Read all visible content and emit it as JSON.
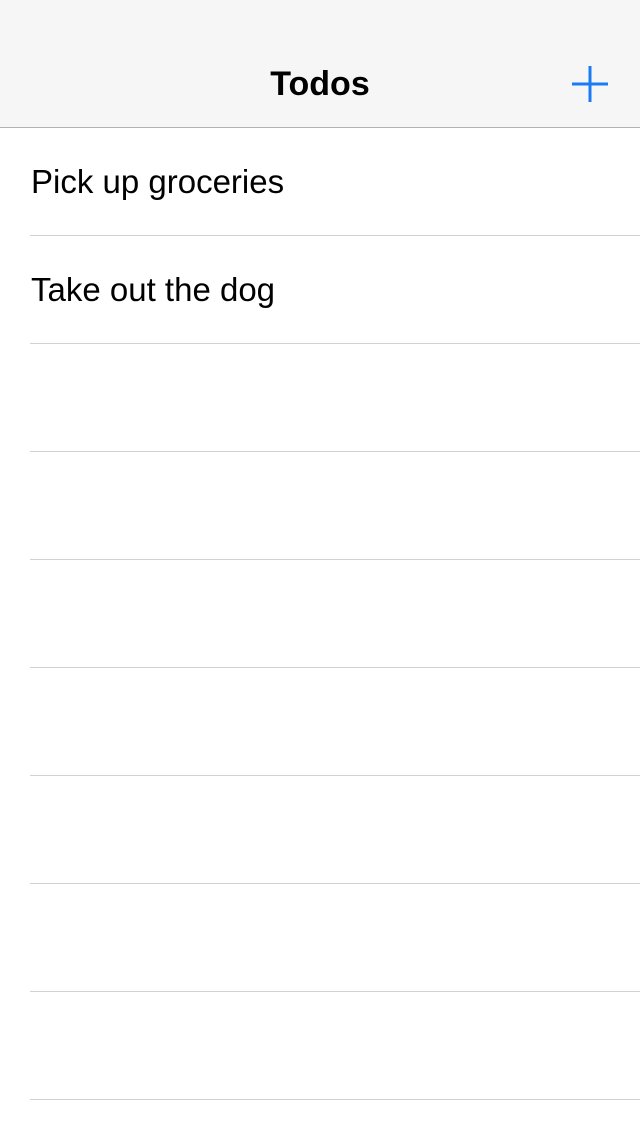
{
  "nav": {
    "title": "Todos",
    "add_icon": "plus-icon",
    "accent_color": "#1a7cf5"
  },
  "todos": [
    {
      "label": "Pick up groceries"
    },
    {
      "label": "Take out the dog"
    },
    {
      "label": ""
    },
    {
      "label": ""
    },
    {
      "label": ""
    },
    {
      "label": ""
    },
    {
      "label": ""
    },
    {
      "label": ""
    },
    {
      "label": ""
    }
  ]
}
